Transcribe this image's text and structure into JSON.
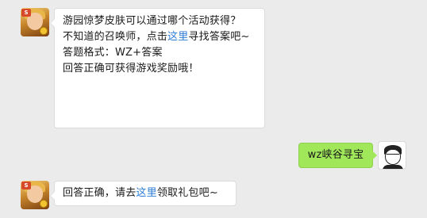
{
  "messages": [
    {
      "sender": "bot",
      "lines": {
        "question": "游园惊梦皮肤可以通过哪个活动获得？",
        "hint_before": "不知道的召唤师，点击",
        "hint_link": "这里",
        "hint_after": "寻找答案吧~",
        "format": "答题格式：WZ+答案",
        "reward": "回答正确可获得游戏奖励哦！"
      }
    },
    {
      "sender": "user",
      "text": "wz峡谷寻宝"
    },
    {
      "sender": "bot",
      "lines": {
        "reply_before": "回答正确，请去",
        "reply_link": "这里",
        "reply_after": "领取礼包吧~"
      }
    }
  ],
  "colors": {
    "background": "#ebebeb",
    "bot_bubble": "#ffffff",
    "user_bubble": "#a0e75a",
    "link": "#2a7bd6"
  },
  "icons": {
    "bot_avatar": "game-hero-avatar",
    "user_avatar": "cartoon-man-avatar"
  }
}
